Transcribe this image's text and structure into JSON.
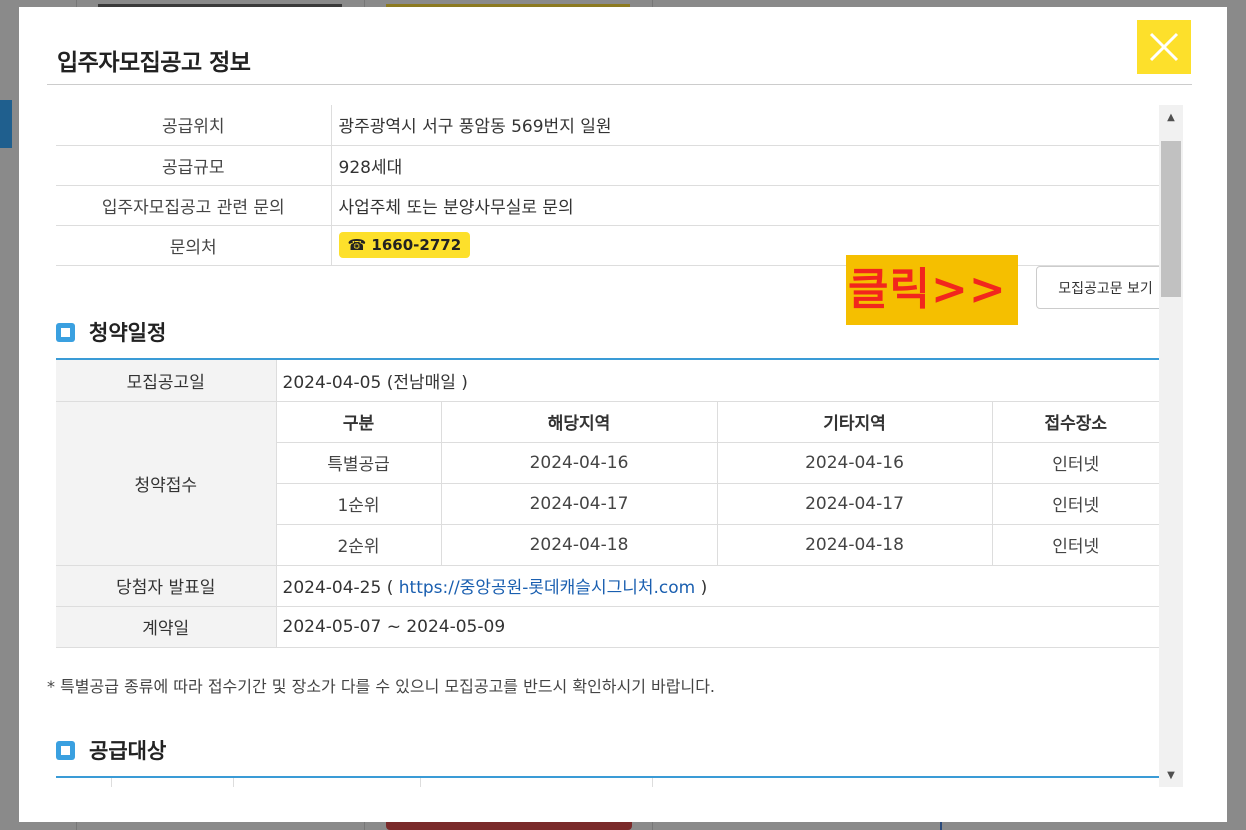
{
  "modal": {
    "title": "입주자모집공고 정보"
  },
  "info": {
    "rows": [
      {
        "label": "공급위치",
        "value": "광주광역시 서구 풍암동 569번지 일원"
      },
      {
        "label": "공급규모",
        "value": "928세대"
      },
      {
        "label": "입주자모집공고 관련 문의",
        "value": "사업주체 또는 분양사무실로 문의"
      },
      {
        "label": "문의처",
        "value": "☎ 1660-2772"
      }
    ]
  },
  "annotation": {
    "text": "클릭>>"
  },
  "notice_button": {
    "label": "모집공고문 보기"
  },
  "schedule": {
    "title": "청약일정",
    "announce_label": "모집공고일",
    "announce_value": "2024-04-05 (전남매일 )",
    "apply_label": "청약접수",
    "headers": [
      "구분",
      "해당지역",
      "기타지역",
      "접수장소"
    ],
    "rows": [
      [
        "특별공급",
        "2024-04-16",
        "2024-04-16",
        "인터넷"
      ],
      [
        "1순위",
        "2024-04-17",
        "2024-04-17",
        "인터넷"
      ],
      [
        "2순위",
        "2024-04-18",
        "2024-04-18",
        "인터넷"
      ]
    ],
    "winner_label": "당첨자 발표일",
    "winner_date": "2024-04-25 (",
    "winner_link": "https://중앙공원-롯데캐슬시그니처.com",
    "winner_close": ")",
    "contract_label": "계약일",
    "contract_value": "2024-05-07 ~ 2024-05-09"
  },
  "footnote": "* 특별공급 종류에 따라 접수기간 및 장소가 다를 수 있으니 모집공고를 반드시 확인하시기 바랍니다.",
  "supply": {
    "title": "공급대상"
  },
  "colors": {
    "accent": "#fde02b",
    "link": "#1a5fb0",
    "section_rule": "#3a9bd6",
    "annotation_bg": "#f5bf00",
    "annotation_text": "#f2261d"
  }
}
